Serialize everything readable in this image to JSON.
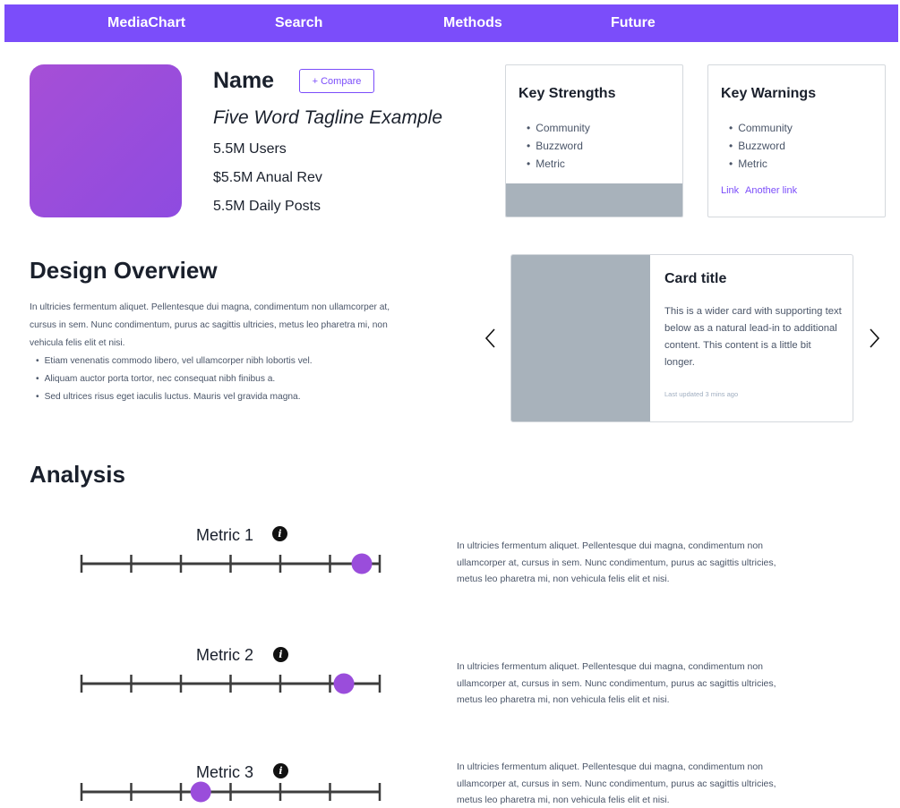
{
  "nav": {
    "items": [
      {
        "label": "MediaChart"
      },
      {
        "label": "Search"
      },
      {
        "label": "Methods"
      },
      {
        "label": "Future"
      }
    ],
    "background": "#7b4dfa"
  },
  "profile": {
    "name": "Name",
    "compare_label": "+ Compare",
    "tagline": "Five Word Tagline Example",
    "stats": [
      "5.5M Users",
      "$5.5M Anual Rev",
      "5.5M Daily Posts"
    ],
    "avatar_color": "#9a4ddb"
  },
  "strengths": {
    "title": "Key Strengths",
    "items": [
      "Community",
      "Buzzword",
      "Metric"
    ]
  },
  "warnings": {
    "title": "Key Warnings",
    "items": [
      "Community",
      "Buzzword",
      "Metric"
    ],
    "links": [
      "Link",
      "Another link"
    ]
  },
  "overview": {
    "heading": "Design Overview",
    "paragraph": "In ultricies fermentum aliquet. Pellentesque dui magna, condimentum non ullamcorper at, cursus in sem. Nunc condimentum, purus ac sagittis ultricies, metus leo pharetra mi, non vehicula felis elit et nisi.",
    "bullets": [
      "Etiam venenatis commodo libero, vel ullamcorper nibh lobortis vel.",
      "Aliquam auctor porta tortor, nec consequat nibh finibus a.",
      "Sed ultrices risus eget iaculis luctus. Mauris vel gravida magna."
    ]
  },
  "card": {
    "title": "Card title",
    "text": "This is a wider card with supporting text below as a natural lead-in to additional content. This content is a little bit longer.",
    "updated": "Last updated 3 mins ago"
  },
  "analysis": {
    "heading": "Analysis",
    "info_icon": "info-icon",
    "metrics": [
      {
        "label": "Metric 1",
        "value": 0.94,
        "description": "In ultricies fermentum aliquet. Pellentesque dui magna, condimentum non ullamcorper at, cursus in sem. Nunc condimentum, purus ac sagittis ultricies, metus leo pharetra mi, non vehicula felis elit et nisi."
      },
      {
        "label": "Metric 2",
        "value": 0.88,
        "description": "In ultricies fermentum aliquet. Pellentesque dui magna, condimentum non ullamcorper at, cursus in sem. Nunc condimentum, purus ac sagittis ultricies, metus leo pharetra mi, non vehicula felis elit et nisi."
      },
      {
        "label": "Metric 3",
        "value": 0.4,
        "description": "In ultricies fermentum aliquet. Pellentesque dui magna, condimentum non ullamcorper at, cursus in sem. Nunc condimentum, purus ac sagittis ultricies, metus leo pharetra mi, non vehicula felis elit et nisi."
      }
    ],
    "slider_color": "#9a4ddb"
  }
}
